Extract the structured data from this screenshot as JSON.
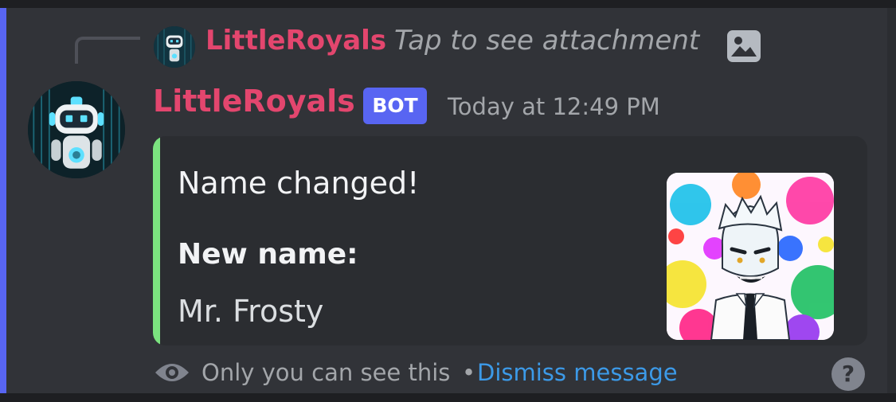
{
  "reply": {
    "author": "LittleRoyals",
    "text": "Tap to see attachment",
    "attachment_icon": "image-icon"
  },
  "message": {
    "author": "LittleRoyals",
    "badge": "BOT",
    "timestamp": "Today at 12:49 PM",
    "author_color": "#e3466e"
  },
  "embed": {
    "accent_color": "#7be37f",
    "title": "Name changed!",
    "fields": [
      {
        "name": "New name:",
        "value": "Mr. Frosty"
      }
    ]
  },
  "ephemeral": {
    "icon": "eye-icon",
    "notice": "Only you can see this",
    "separator": "•",
    "dismiss_label": "Dismiss message",
    "help_glyph": "?"
  },
  "colors": {
    "mention_bar": "#5865f2",
    "bot_badge": "#5865f2",
    "link": "#3c9ae8"
  }
}
